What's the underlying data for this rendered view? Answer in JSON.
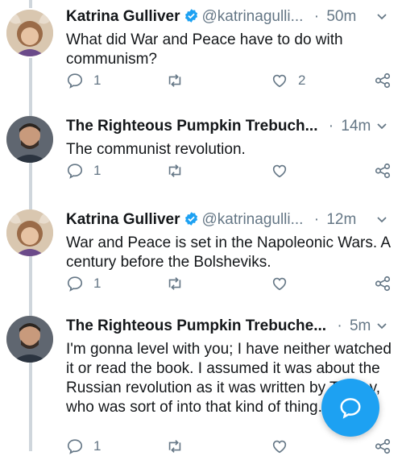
{
  "tweets": [
    {
      "author": "Katrina Gulliver",
      "verified": true,
      "handle": "@katrinagulli...",
      "dot": "·",
      "time": "50m",
      "text": "What did War and Peace have to do with communism?",
      "reply_count": "1",
      "like_count": "2"
    },
    {
      "author": "The Righteous Pumpkin Trebuch...",
      "verified": false,
      "handle": "",
      "dot": "·",
      "time": "14m",
      "text": "The communist revolution.",
      "reply_count": "1",
      "like_count": ""
    },
    {
      "author": "Katrina Gulliver",
      "verified": true,
      "handle": "@katrinagulli...",
      "dot": "·",
      "time": "12m",
      "text": "War and Peace is set in the Napoleonic Wars. A century before the Bolsheviks.",
      "reply_count": "1",
      "like_count": ""
    },
    {
      "author": "The Righteous Pumpkin Trebuche...",
      "verified": false,
      "handle": "",
      "dot": "·",
      "time": "5m",
      "text": "I'm gonna level with you; I have neither watched it or read the book. I assumed it was about the Russian revolution as it was written by Tolstoy, who was sort of into that kind of thing.",
      "reply_count": "1",
      "like_count": ""
    }
  ],
  "colors": {
    "text": "#14171a",
    "muted": "#657786",
    "accent": "#1da1f2",
    "thread_line": "#cfd6dc"
  },
  "icons": {
    "reply": "reply-icon",
    "retweet": "retweet-icon",
    "like": "heart-icon",
    "share": "share-icon",
    "compose": "compose-message-icon",
    "verified": "verified-badge-icon",
    "caret": "chevron-down-icon"
  }
}
